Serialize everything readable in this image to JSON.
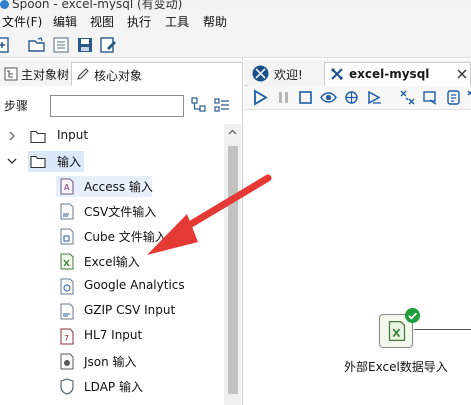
{
  "window": {
    "title": "Spoon - excel-mysql (有变动)"
  },
  "menu": [
    "文件(F)",
    "编辑",
    "视图",
    "执行",
    "工具",
    "帮助"
  ],
  "left_tabs": [
    {
      "label": "主对象树",
      "icon": "tree-icon"
    },
    {
      "label": "核心对象",
      "icon": "pencil-icon"
    }
  ],
  "search": {
    "label": "步骤",
    "value": ""
  },
  "tree": [
    {
      "label": "Input",
      "icon": "folder-icon",
      "expanded": false,
      "level": 0
    },
    {
      "label": "输入",
      "icon": "folder-icon",
      "expanded": true,
      "level": 0,
      "selected": true
    },
    {
      "label": "Access 输入",
      "icon": "access-input-icon",
      "level": 1
    },
    {
      "label": "CSV文件输入",
      "icon": "csv-file-input-icon",
      "level": 1
    },
    {
      "label": "Cube 文件输入",
      "icon": "cube-file-input-icon",
      "level": 1
    },
    {
      "label": "Excel输入",
      "icon": "excel-input-icon",
      "level": 1
    },
    {
      "label": "Google Analytics",
      "icon": "google-analytics-icon",
      "level": 1
    },
    {
      "label": "GZIP CSV Input",
      "icon": "gzip-csv-input-icon",
      "level": 1
    },
    {
      "label": "HL7 Input",
      "icon": "hl7-input-icon",
      "level": 1
    },
    {
      "label": "Json 输入",
      "icon": "json-input-icon",
      "level": 1
    },
    {
      "label": "LDAP 输入",
      "icon": "ldap-input-icon",
      "level": 1
    }
  ],
  "right_tabs": [
    {
      "label": "欢迎!",
      "icon": "welcome-icon"
    },
    {
      "label": "excel-mysql",
      "icon": "transformation-icon"
    }
  ],
  "canvas": {
    "step": {
      "label": "外部Excel数据导入",
      "icon": "excel-input-icon",
      "status": "success"
    }
  },
  "colors": {
    "accent_red": "#e53935",
    "success_green": "#1f9e3c",
    "selection": "#dbe8f8",
    "play_blue": "#1c5da8"
  }
}
